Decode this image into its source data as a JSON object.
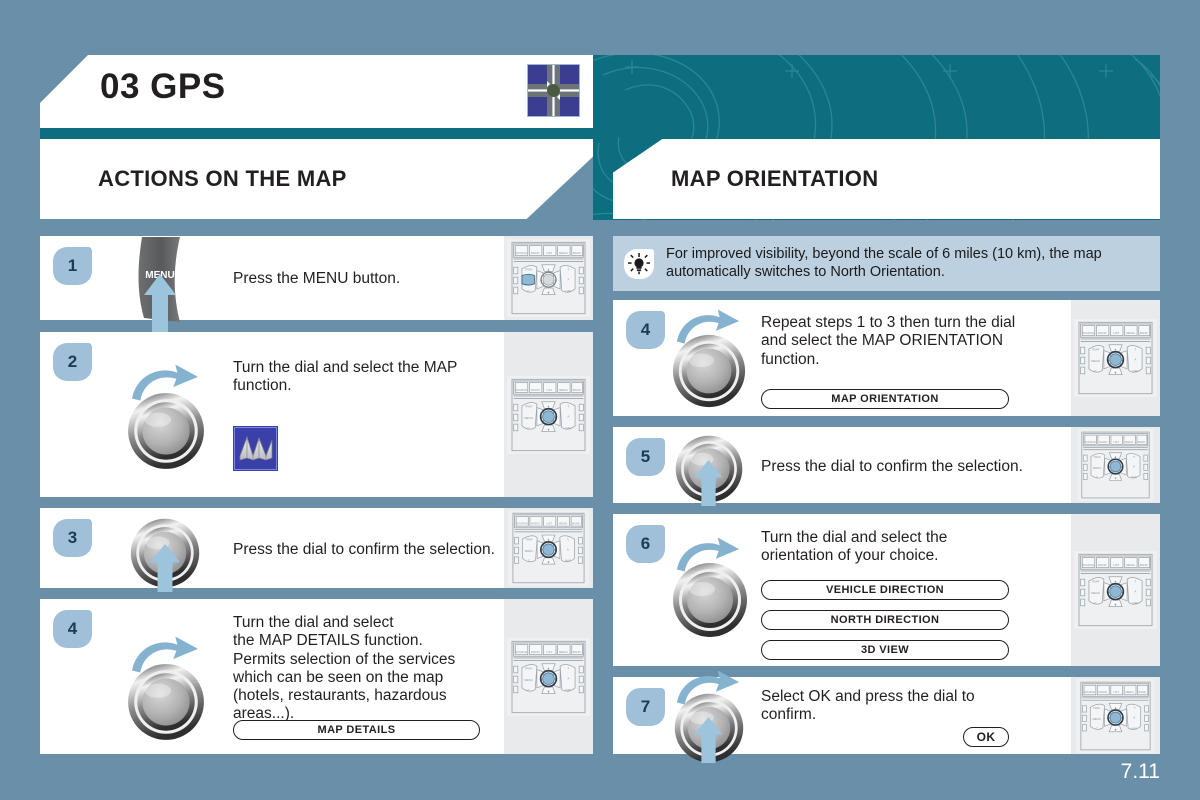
{
  "header": {
    "chapter_number": "03",
    "chapter_title": "03 GPS",
    "icon": "junction-map-icon",
    "accent_teal": "#0d6e80",
    "page_background": "#6a90a9"
  },
  "sections": [
    {
      "id": "actions-on-the-map",
      "title": "ACTIONS ON THE MAP"
    },
    {
      "id": "map-orientation",
      "title": "MAP ORIENTATION"
    }
  ],
  "left_column": {
    "steps": [
      {
        "number": "1",
        "text": "Press the MENU button.",
        "graphic": "menu-button",
        "menu_label": "MENU",
        "pills": []
      },
      {
        "number": "2",
        "text": "Turn the dial and select the MAP function.",
        "graphic": "turn-dial",
        "icon": "map-function-icon",
        "pills": []
      },
      {
        "number": "3",
        "text": "Press the dial to confirm the selection.",
        "graphic": "press-dial",
        "pills": []
      },
      {
        "number": "4",
        "text": "Turn the dial and select\nthe MAP DETAILS function.\nPermits selection of the services\nwhich can be seen on the map\n(hotels, restaurants, hazardous\nareas...).",
        "graphic": "turn-dial",
        "pills": [
          "MAP DETAILS"
        ]
      }
    ]
  },
  "right_column": {
    "tip": {
      "icon": "lightbulb-icon",
      "text": "For improved visibility, beyond the scale of 6 miles (10 km), the map automatically switches to North Orientation."
    },
    "steps": [
      {
        "number": "4",
        "text": "Repeat steps 1 to 3 then turn the dial\nand select the MAP ORIENTATION\nfunction.",
        "graphic": "turn-dial",
        "pills": [
          "MAP ORIENTATION"
        ]
      },
      {
        "number": "5",
        "text": "Press the dial to confirm the selection.",
        "graphic": "press-dial",
        "pills": []
      },
      {
        "number": "6",
        "text": "Turn the dial and select the\norientation of your choice.",
        "graphic": "turn-dial",
        "pills": [
          "VEHICLE DIRECTION",
          "NORTH DIRECTION",
          "3D VIEW"
        ]
      },
      {
        "number": "7",
        "text": "Select OK and press the dial to\nconfirm.",
        "graphic": "turn-and-press-dial",
        "pills": [
          "OK"
        ]
      }
    ]
  },
  "footer": {
    "page_number": "7.11"
  }
}
